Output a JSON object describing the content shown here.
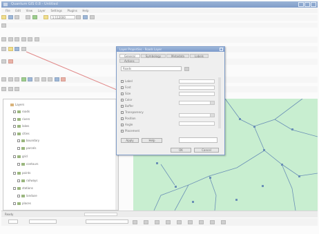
{
  "window": {
    "title": "Quantum GIS 0.8 - Untitled"
  },
  "menu": {
    "items": [
      "File",
      "Edit",
      "View",
      "Layer",
      "Settings",
      "Plugins",
      "Help"
    ]
  },
  "toolbar": {
    "scale_label": "1:112000"
  },
  "dialog": {
    "title": "Layer Properties - Roads Layer",
    "tabs": [
      "General",
      "Symbology",
      "Metadata",
      "Labels",
      "Actions"
    ],
    "display_name": "Roads",
    "properties": [
      {
        "label": "Label"
      },
      {
        "label": "Font"
      },
      {
        "label": "Size"
      },
      {
        "label": "Color"
      },
      {
        "label": "Buffer"
      },
      {
        "label": "Transparency"
      },
      {
        "label": "Position"
      },
      {
        "label": "Angle"
      },
      {
        "label": "Placement"
      }
    ],
    "buttons": {
      "apply": "Apply",
      "ok": "OK",
      "cancel": "Cancel",
      "help": "Help"
    }
  },
  "layers": {
    "items": [
      {
        "name": "Layers"
      },
      {
        "name": "roads"
      },
      {
        "name": "rivers"
      },
      {
        "name": "lakes"
      },
      {
        "name": "cities"
      },
      {
        "name": "boundary"
      },
      {
        "name": "parcels"
      },
      {
        "name": "grid"
      },
      {
        "name": "contours"
      },
      {
        "name": "points"
      },
      {
        "name": "railways"
      },
      {
        "name": "stations"
      },
      {
        "name": "landuse"
      },
      {
        "name": "places"
      }
    ]
  },
  "status": {
    "text": "Ready"
  },
  "colors": {
    "map_fill": "#c8eed0",
    "accent": "#7f9cc8",
    "road_line": "#6a8fb6"
  }
}
